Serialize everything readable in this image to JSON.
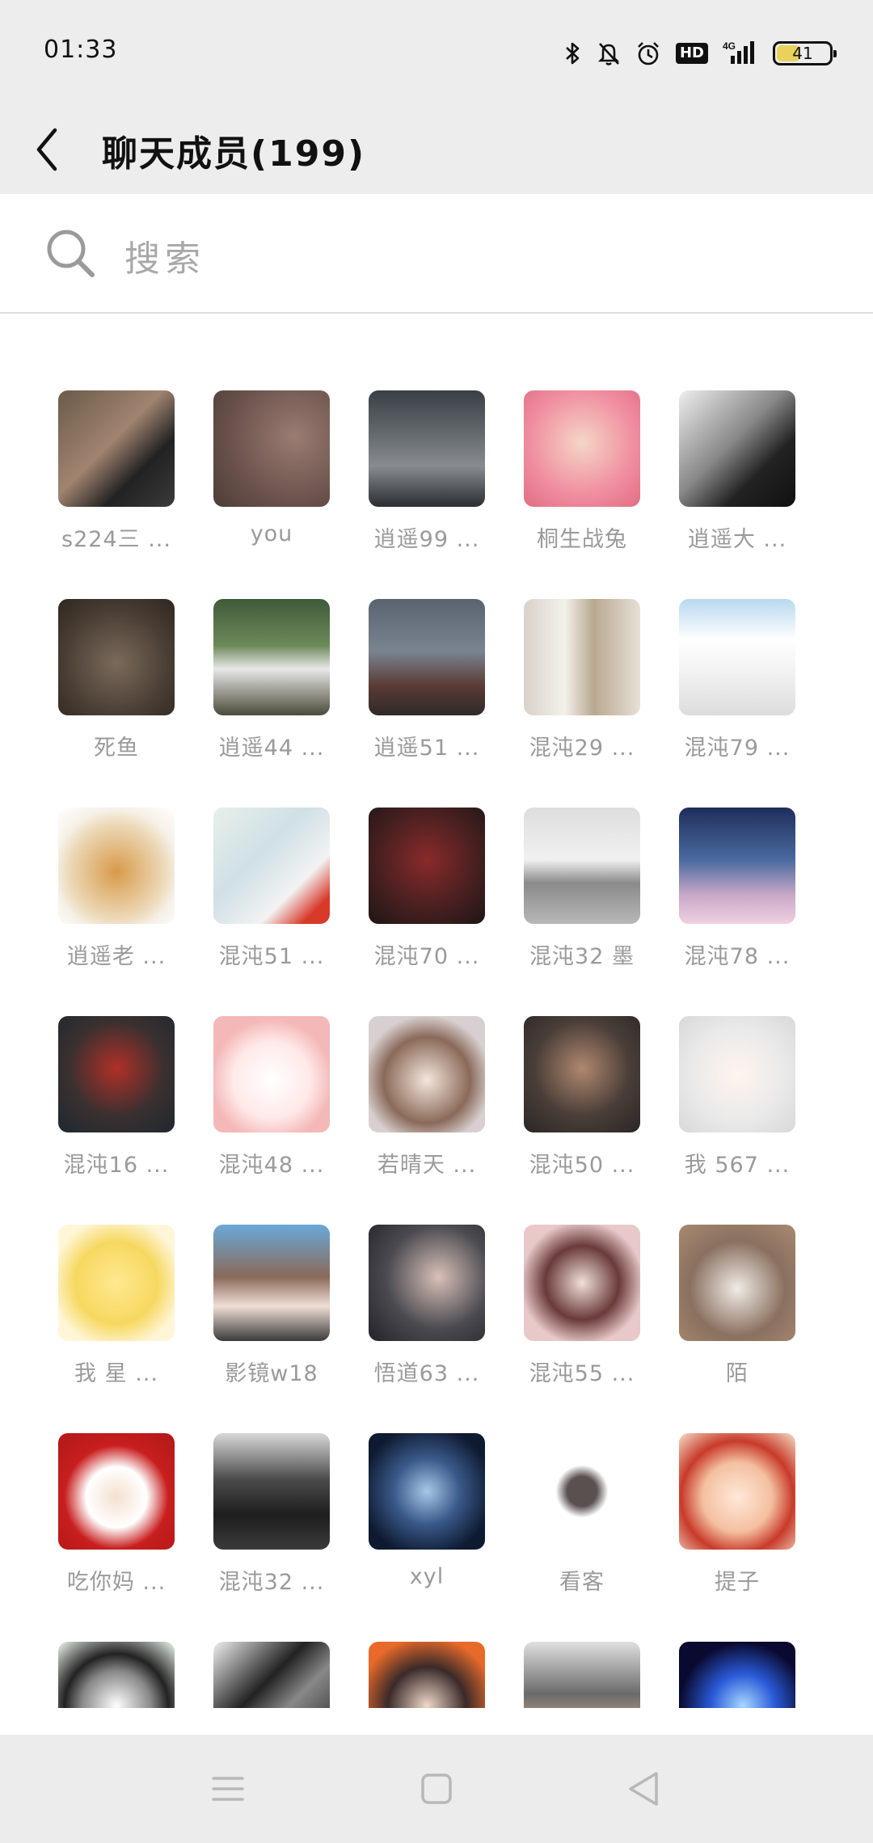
{
  "status_bar": {
    "time": "01:33",
    "battery_level": "41",
    "network": "4G",
    "hd": "HD"
  },
  "header": {
    "title": "聊天成员(199)"
  },
  "search": {
    "placeholder": "搜索"
  },
  "members": [
    {
      "name": "s224三 ...",
      "bg": "linear-gradient(135deg,#6b5a4a,#a08470 45%,#222 70%,#3a3a3a)"
    },
    {
      "name": "you",
      "bg": "radial-gradient(circle at 70% 40%,#9a7c72,#6b524c 60%,#4e3d38)"
    },
    {
      "name": "逍遥99 ...",
      "bg": "linear-gradient(180deg,#3a3f45,#6e7378 45%,#888c90 65%,#2a2d31)"
    },
    {
      "name": "桐生战兔",
      "bg": "radial-gradient(circle at 50% 45%,#f5d6c6,#f08ea0 60%,#e26c84)"
    },
    {
      "name": "逍遥大 ...",
      "bg": "linear-gradient(135deg,#eeeeee,#888 45%,#222 70%,#111)"
    },
    {
      "name": "死鱼",
      "bg": "radial-gradient(circle at 50% 55%,#7a6a5a,#4a3e34 60%,#2e2620)"
    },
    {
      "name": "逍遥44 ...",
      "bg": "linear-gradient(180deg,#3f5a3a,#6d8a5a 40%,#e8e8e8 60%,#4a4a3a)"
    },
    {
      "name": "逍遥51 ...",
      "bg": "linear-gradient(180deg,#5a6470,#7a8490 45%,#5a3a34 75%,#2e2a2a)"
    },
    {
      "name": "混沌29 ...",
      "bg": "linear-gradient(90deg,#d8d2c8,#f4f1ec 35%,#b8a890 60%,#e6e0d6)"
    },
    {
      "name": "混沌79 ...",
      "bg": "linear-gradient(180deg,#b8d8ee,#ffffff 35%,#eeeeee 70%,#dcdcdc)"
    },
    {
      "name": "逍遥老 ...",
      "bg": "radial-gradient(circle at 50% 55%,#d89a4a,#ecd9b8 55%,#f6f1e8 72%,#ffffff)"
    },
    {
      "name": "混沌51 ...",
      "bg": "linear-gradient(135deg,#e8efe8,#cfe0e6 40%,#f2f2f2 70%,#d83a2a 88%)"
    },
    {
      "name": "混沌70 ...",
      "bg": "radial-gradient(circle at 50% 45%,#8a2a2a,#4a2020 55%,#1e1616)"
    },
    {
      "name": "混沌32 墨",
      "bg": "linear-gradient(180deg,#dedede,#f0f0f0 45%,#8a8a8a 65%,#b8b8b8)"
    },
    {
      "name": "混沌78 ...",
      "bg": "linear-gradient(180deg,#1e2e5a,#4a6aa0 45%,#c8a8c8 75%,#f0d0e0)"
    },
    {
      "name": "混沌16 ...",
      "bg": "radial-gradient(circle at 50% 45%,#b03028,#3a3030 55%,#1e2830)"
    },
    {
      "name": "混沌48 ...",
      "bg": "radial-gradient(circle at 50% 55%,#ffffff,#ffe8e8 45%,#f4b8b8 70%)"
    },
    {
      "name": "若晴天 ...",
      "bg": "radial-gradient(circle at 50% 55%,#f4e6dc,#8a6a5a 50%,#d8d0d0 75%)"
    },
    {
      "name": "混沌50 ...",
      "bg": "radial-gradient(circle at 50% 45%,#b08870,#4a3e38 55%,#2a2626)"
    },
    {
      "name": "我 567 ...",
      "bg": "radial-gradient(circle at 50% 50%,#fff4ee,#eaeaea 55%,#d8d8d8)"
    },
    {
      "name": "我 星 ...",
      "bg": "radial-gradient(circle at 50% 50%,#ffe890,#f6d860 50%,#fff6d8 80%)"
    },
    {
      "name": "影镜w18",
      "bg": "linear-gradient(180deg,#6aa8d8,#8a6a5a 45%,#f0ded6 70%,#3a3a3a)"
    },
    {
      "name": "悟道63 ...",
      "bg": "radial-gradient(circle at 60% 45%,#d8c0b8,#4a4a50 55%,#222228)"
    },
    {
      "name": "混沌55 ...",
      "bg": "radial-gradient(circle at 50% 50%,#f0e0d8,#6a3a3a 45%,#e8c8c8 75%)"
    },
    {
      "name": "陌",
      "bg": "radial-gradient(circle at 50% 55%,#f0ece6,#8a7060 55%,#a88a70)"
    },
    {
      "name": "吃你妈 ...",
      "bg": "radial-gradient(circle at 50% 55%,#f4e0d0,#ffffff 35%,#c81e1e 60%,#b01818)"
    },
    {
      "name": "混沌32 ...",
      "bg": "linear-gradient(180deg,#d8d8d8,#4a4a4a 40%,#1e1e1e 70%,#3a3a3a)"
    },
    {
      "name": "xyl",
      "bg": "radial-gradient(ellipse at 50% 50%,#a8c8e8,#3a5a8a 40%,#0e1a30 80%)"
    },
    {
      "name": "看客",
      "bg": "radial-gradient(circle at 50% 50%,#5a5050 0,#5a5050 18%,#ffffff 32%)"
    },
    {
      "name": "提子",
      "bg": "radial-gradient(circle at 50% 55%,#ffe8d8,#f4c0a0 40%,#c83a2a 65%,#f4e0c8)"
    },
    {
      "name": "",
      "bg": "radial-gradient(circle at 50% 55%,#ffffff,#888888 40%,#222222 60%,#f0f8f0)"
    },
    {
      "name": "",
      "bg": "linear-gradient(135deg,#f0f0f0,#222 40%,#888 60%,#1a1a1a)"
    },
    {
      "name": "",
      "bg": "radial-gradient(circle at 50% 55%,#f0d8c8,#3a2a2a 45%,#e86a2a 80%)"
    },
    {
      "name": "",
      "bg": "linear-gradient(180deg,#e0e0e0,#6a6a6a 45%,#c8a890 75%)"
    },
    {
      "name": "",
      "bg": "radial-gradient(circle at 55% 55%,#a8d8ff,#2a5ad8 35%,#0a0a30 70%)"
    }
  ],
  "nav": {
    "menu_icon": "menu-icon",
    "home_icon": "home-icon",
    "back_icon": "back-triangle-icon"
  }
}
